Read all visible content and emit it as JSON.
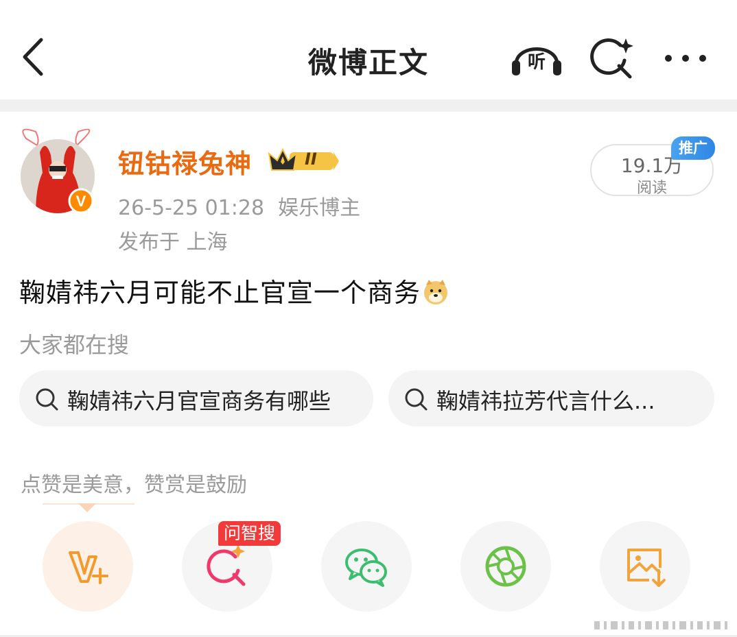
{
  "header": {
    "title": "微博正文",
    "listen_label": "听"
  },
  "post": {
    "author_name": "钮钴禄兔神",
    "member_level": "II",
    "datetime": "26-5-25 01:28",
    "category": "娱乐博主",
    "location": "发布于 上海",
    "reads_count": "19.1万",
    "reads_label": "阅读",
    "promo_tag": "推广",
    "text": "鞠婧祎六月可能不止官宣一个商务"
  },
  "hot_search": {
    "title": "大家都在搜",
    "items": [
      {
        "label": "鞠婧祎六月官宣商务有哪些"
      },
      {
        "label": "鞠婧祎拉芳代言什么..."
      }
    ]
  },
  "support": {
    "hint": "点赞是美意，赞赏是鼓励"
  },
  "share": {
    "ai_tag": "问智搜",
    "buttons": [
      {
        "icon": "v-plus-icon",
        "color": "#f39a2c"
      },
      {
        "icon": "ai-search-icon",
        "color": "#f0386a"
      },
      {
        "icon": "wechat-icon",
        "color": "#3cbd6f"
      },
      {
        "icon": "moments-icon",
        "color": "#6cc149"
      },
      {
        "icon": "save-image-icon",
        "color": "#f0a43a"
      }
    ]
  },
  "colors": {
    "accent_orange": "#e86b12",
    "promo_blue": "#2f86e6",
    "ai_red": "#f23a3a",
    "muted_text": "#9a9a9a"
  }
}
